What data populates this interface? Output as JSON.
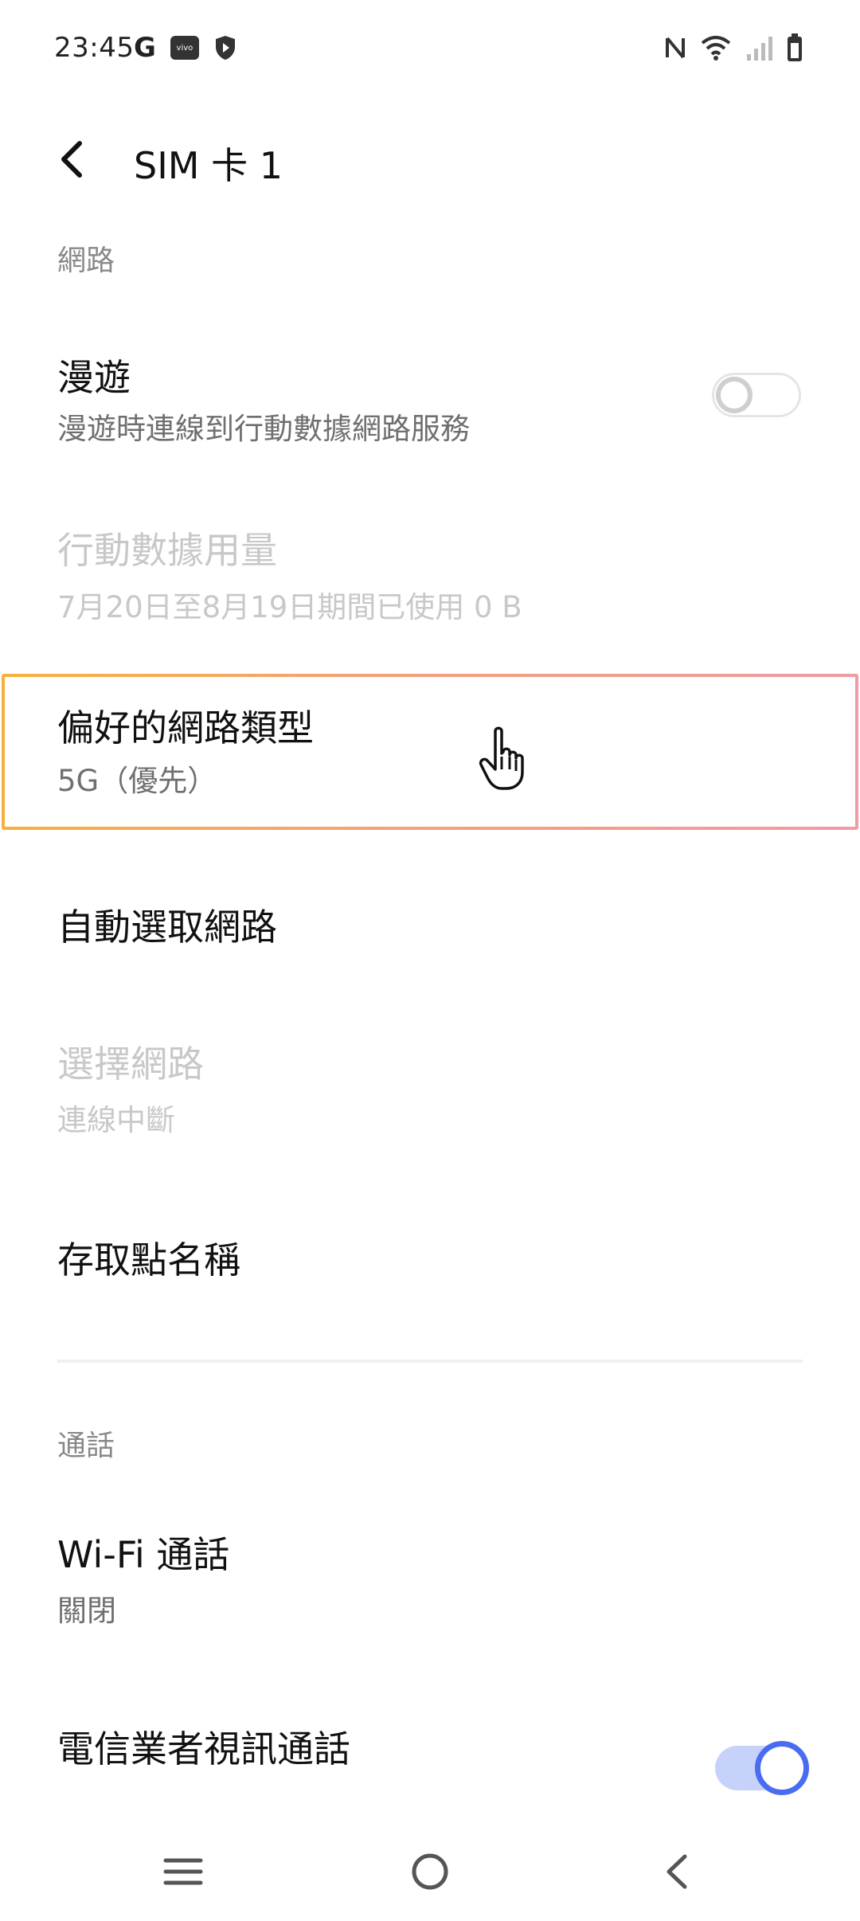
{
  "status_bar": {
    "time": "23:45",
    "google_glyph": "G",
    "vivo_label": "vivo",
    "icons": [
      "google-icon",
      "vivo-app-icon",
      "shield-icon",
      "nfc-icon",
      "wifi-icon",
      "signal-icon",
      "battery-icon"
    ]
  },
  "header": {
    "title": "SIM 卡 1"
  },
  "sections": {
    "network": "網路",
    "calls": "通話"
  },
  "rows": {
    "roaming": {
      "title": "漫遊",
      "subtitle": "漫遊時連線到行動數據網路服務",
      "toggle_on": false
    },
    "data_usage": {
      "title": "行動數據用量",
      "subtitle": "7月20日至8月19日期間已使用 0 B",
      "disabled": true
    },
    "preferred_network": {
      "title": "偏好的網路類型",
      "subtitle": "5G（優先）",
      "highlighted": true
    },
    "auto_select": {
      "title": "自動選取網路"
    },
    "choose_network": {
      "title": "選擇網路",
      "subtitle": "連線中斷",
      "disabled": true
    },
    "apn": {
      "title": "存取點名稱"
    },
    "wifi_calling": {
      "title": "Wi-Fi 通話",
      "subtitle": "關閉"
    },
    "video_calling": {
      "title": "電信業者視訊通話",
      "toggle_on": true
    }
  },
  "colors": {
    "accent": "#4a6cf0",
    "toggle_track_on": "#c7d2fb",
    "disabled_text": "#c8c8c8",
    "highlight_gradient": [
      "#f6b13d",
      "#f29aa6"
    ]
  },
  "nav_bar": {
    "icons": [
      "menu-icon",
      "home-icon",
      "back-icon"
    ]
  }
}
